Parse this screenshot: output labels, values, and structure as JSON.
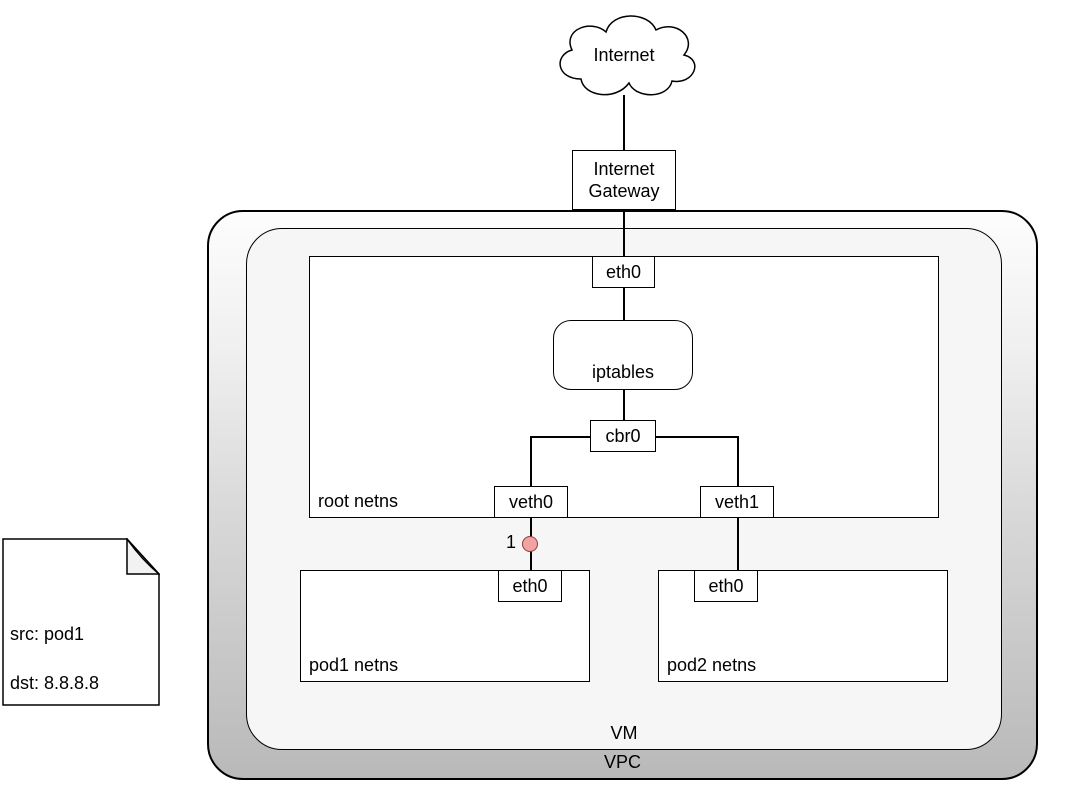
{
  "cloud": {
    "label": "Internet"
  },
  "internet_gateway": {
    "label": "Internet\nGateway"
  },
  "vpc": {
    "label": "VPC"
  },
  "vm": {
    "label": "VM"
  },
  "root_netns": {
    "label": "root netns"
  },
  "eth0_vm": {
    "label": "eth0"
  },
  "iptables": {
    "label": "iptables"
  },
  "cbr0": {
    "label": "cbr0"
  },
  "veth0": {
    "label": "veth0"
  },
  "veth1": {
    "label": "veth1"
  },
  "pod1": {
    "netns_label": "pod1 netns",
    "eth_label": "eth0"
  },
  "pod2": {
    "netns_label": "pod2 netns",
    "eth_label": "eth0"
  },
  "marker1": {
    "label": "1"
  },
  "note": {
    "line1": "src: pod1",
    "line2": "dst: 8.8.8.8"
  }
}
